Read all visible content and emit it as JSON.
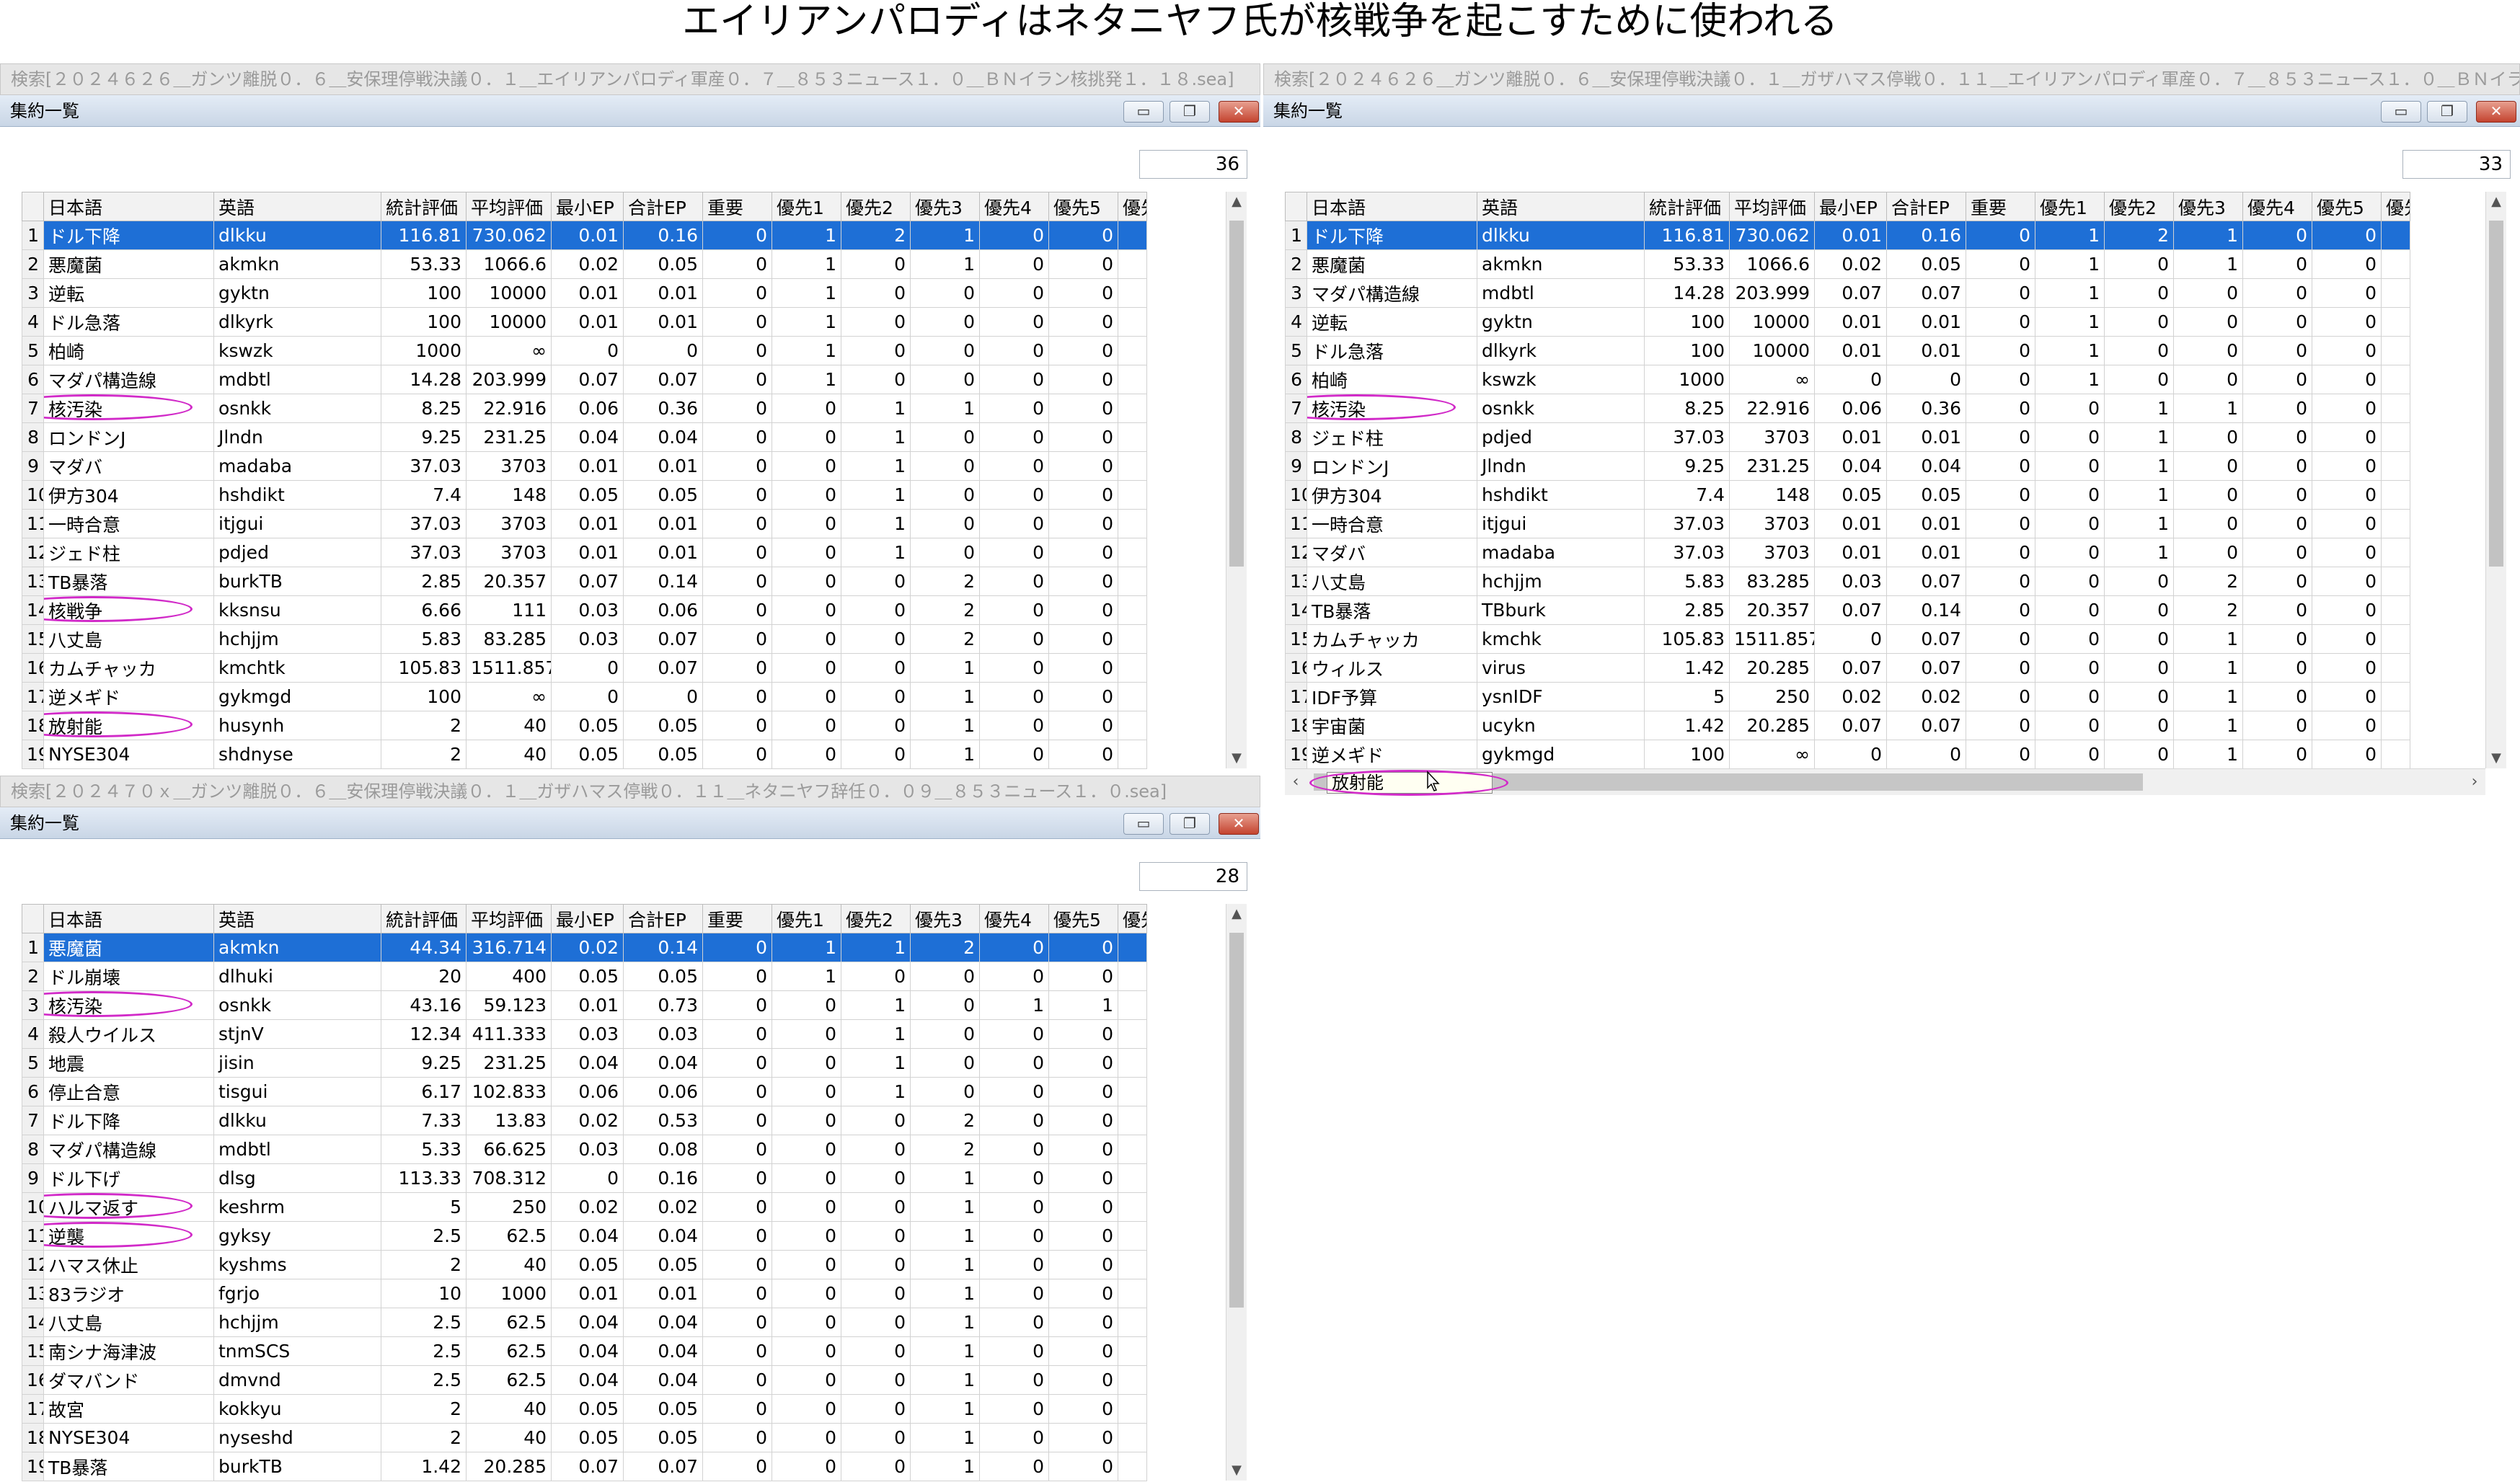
{
  "page_title": "エイリアンパロディはネタニヤフ氏が核戦争を起こすために使われる",
  "columns": [
    "日本語",
    "英語",
    "統計評価",
    "平均評価",
    "最小EP",
    "合計EP",
    "重要",
    "優先1",
    "優先2",
    "優先3",
    "優先4",
    "優先5",
    "優先"
  ],
  "windows": {
    "a": {
      "search_label": "検索",
      "search_text": "[２０２４６２６＿ガンツ離脱０．６＿安保理停戦決議０．１＿エイリアンパロディ軍産０．７＿８５３ニュース１．０＿ＢＮイラン核挑発１．１８.sea]",
      "window_title": "集約一覧",
      "count": "36",
      "rows": [
        {
          "i": "1",
          "ja": "ドル下降",
          "en": "dlkku",
          "v": [
            "116.81",
            "730.062",
            "0.01",
            "0.16",
            "0",
            "1",
            "2",
            "1",
            "0",
            "0"
          ],
          "sel": true
        },
        {
          "i": "2",
          "ja": "悪魔菌",
          "en": "akmkn",
          "v": [
            "53.33",
            "1066.6",
            "0.02",
            "0.05",
            "0",
            "1",
            "0",
            "1",
            "0",
            "0"
          ]
        },
        {
          "i": "3",
          "ja": "逆転",
          "en": "gyktn",
          "v": [
            "100",
            "10000",
            "0.01",
            "0.01",
            "0",
            "1",
            "0",
            "0",
            "0",
            "0"
          ]
        },
        {
          "i": "4",
          "ja": "ドル急落",
          "en": "dlkyrk",
          "v": [
            "100",
            "10000",
            "0.01",
            "0.01",
            "0",
            "1",
            "0",
            "0",
            "0",
            "0"
          ]
        },
        {
          "i": "5",
          "ja": "柏崎",
          "en": "kswzk",
          "v": [
            "1000",
            "∞",
            "0",
            "0",
            "0",
            "1",
            "0",
            "0",
            "0",
            "0"
          ]
        },
        {
          "i": "6",
          "ja": "マダパ構造線",
          "en": "mdbtl",
          "v": [
            "14.28",
            "203.999",
            "0.07",
            "0.07",
            "0",
            "1",
            "0",
            "0",
            "0",
            "0"
          ]
        },
        {
          "i": "7",
          "ja": "核汚染",
          "en": "osnkk",
          "v": [
            "8.25",
            "22.916",
            "0.06",
            "0.36",
            "0",
            "0",
            "1",
            "1",
            "0",
            "0"
          ],
          "circled": true
        },
        {
          "i": "8",
          "ja": "ロンドンJ",
          "en": "Jlndn",
          "v": [
            "9.25",
            "231.25",
            "0.04",
            "0.04",
            "0",
            "0",
            "1",
            "0",
            "0",
            "0"
          ]
        },
        {
          "i": "9",
          "ja": "マダバ",
          "en": "madaba",
          "v": [
            "37.03",
            "3703",
            "0.01",
            "0.01",
            "0",
            "0",
            "1",
            "0",
            "0",
            "0"
          ]
        },
        {
          "i": "10",
          "ja": "伊方304",
          "en": "hshdikt",
          "v": [
            "7.4",
            "148",
            "0.05",
            "0.05",
            "0",
            "0",
            "1",
            "0",
            "0",
            "0"
          ]
        },
        {
          "i": "11",
          "ja": "一時合意",
          "en": "itjgui",
          "v": [
            "37.03",
            "3703",
            "0.01",
            "0.01",
            "0",
            "0",
            "1",
            "0",
            "0",
            "0"
          ]
        },
        {
          "i": "12",
          "ja": "ジェド柱",
          "en": "pdjed",
          "v": [
            "37.03",
            "3703",
            "0.01",
            "0.01",
            "0",
            "0",
            "1",
            "0",
            "0",
            "0"
          ]
        },
        {
          "i": "13",
          "ja": "TB暴落",
          "en": "burkTB",
          "v": [
            "2.85",
            "20.357",
            "0.07",
            "0.14",
            "0",
            "0",
            "0",
            "2",
            "0",
            "0"
          ]
        },
        {
          "i": "14",
          "ja": "核戦争",
          "en": "kksnsu",
          "v": [
            "6.66",
            "111",
            "0.03",
            "0.06",
            "0",
            "0",
            "0",
            "2",
            "0",
            "0"
          ],
          "circled": true
        },
        {
          "i": "15",
          "ja": "八丈島",
          "en": "hchjjm",
          "v": [
            "5.83",
            "83.285",
            "0.03",
            "0.07",
            "0",
            "0",
            "0",
            "2",
            "0",
            "0"
          ]
        },
        {
          "i": "16",
          "ja": "カムチャッカ",
          "en": "kmchtk",
          "v": [
            "105.83",
            "1511.857",
            "0",
            "0.07",
            "0",
            "0",
            "0",
            "1",
            "0",
            "0"
          ]
        },
        {
          "i": "17",
          "ja": "逆メギド",
          "en": "gykmgd",
          "v": [
            "100",
            "∞",
            "0",
            "0",
            "0",
            "0",
            "0",
            "1",
            "0",
            "0"
          ]
        },
        {
          "i": "18",
          "ja": "放射能",
          "en": "husynh",
          "v": [
            "2",
            "40",
            "0.05",
            "0.05",
            "0",
            "0",
            "0",
            "1",
            "0",
            "0"
          ],
          "circled": true
        },
        {
          "i": "19",
          "ja": "NYSE304",
          "en": "shdnyse",
          "v": [
            "2",
            "40",
            "0.05",
            "0.05",
            "0",
            "0",
            "0",
            "1",
            "0",
            "0"
          ]
        }
      ]
    },
    "b": {
      "search_label": "検索",
      "search_text": "[２０２４６２６＿ガンツ離脱０．６＿安保理停戦決議０．１＿ガザハマス停戦０．１１＿エイリアンパロディ軍産０．７＿８５３ニュース１．０＿ＢＮイラン核挑発１",
      "window_title": "集約一覧",
      "count": "33",
      "tooltip_text": "放射能",
      "rows": [
        {
          "i": "1",
          "ja": "ドル下降",
          "en": "dlkku",
          "v": [
            "116.81",
            "730.062",
            "0.01",
            "0.16",
            "0",
            "1",
            "2",
            "1",
            "0",
            "0"
          ],
          "sel": true
        },
        {
          "i": "2",
          "ja": "悪魔菌",
          "en": "akmkn",
          "v": [
            "53.33",
            "1066.6",
            "0.02",
            "0.05",
            "0",
            "1",
            "0",
            "1",
            "0",
            "0"
          ]
        },
        {
          "i": "3",
          "ja": "マダパ構造線",
          "en": "mdbtl",
          "v": [
            "14.28",
            "203.999",
            "0.07",
            "0.07",
            "0",
            "1",
            "0",
            "0",
            "0",
            "0"
          ]
        },
        {
          "i": "4",
          "ja": "逆転",
          "en": "gyktn",
          "v": [
            "100",
            "10000",
            "0.01",
            "0.01",
            "0",
            "1",
            "0",
            "0",
            "0",
            "0"
          ]
        },
        {
          "i": "5",
          "ja": "ドル急落",
          "en": "dlkyrk",
          "v": [
            "100",
            "10000",
            "0.01",
            "0.01",
            "0",
            "1",
            "0",
            "0",
            "0",
            "0"
          ]
        },
        {
          "i": "6",
          "ja": "柏崎",
          "en": "kswzk",
          "v": [
            "1000",
            "∞",
            "0",
            "0",
            "0",
            "1",
            "0",
            "0",
            "0",
            "0"
          ]
        },
        {
          "i": "7",
          "ja": "核汚染",
          "en": "osnkk",
          "v": [
            "8.25",
            "22.916",
            "0.06",
            "0.36",
            "0",
            "0",
            "1",
            "1",
            "0",
            "0"
          ],
          "circled": true
        },
        {
          "i": "8",
          "ja": "ジェド柱",
          "en": "pdjed",
          "v": [
            "37.03",
            "3703",
            "0.01",
            "0.01",
            "0",
            "0",
            "1",
            "0",
            "0",
            "0"
          ]
        },
        {
          "i": "9",
          "ja": "ロンドンJ",
          "en": "Jlndn",
          "v": [
            "9.25",
            "231.25",
            "0.04",
            "0.04",
            "0",
            "0",
            "1",
            "0",
            "0",
            "0"
          ]
        },
        {
          "i": "10",
          "ja": "伊方304",
          "en": "hshdikt",
          "v": [
            "7.4",
            "148",
            "0.05",
            "0.05",
            "0",
            "0",
            "1",
            "0",
            "0",
            "0"
          ]
        },
        {
          "i": "11",
          "ja": "一時合意",
          "en": "itjgui",
          "v": [
            "37.03",
            "3703",
            "0.01",
            "0.01",
            "0",
            "0",
            "1",
            "0",
            "0",
            "0"
          ]
        },
        {
          "i": "12",
          "ja": "マダバ",
          "en": "madaba",
          "v": [
            "37.03",
            "3703",
            "0.01",
            "0.01",
            "0",
            "0",
            "1",
            "0",
            "0",
            "0"
          ]
        },
        {
          "i": "13",
          "ja": "八丈島",
          "en": "hchjjm",
          "v": [
            "5.83",
            "83.285",
            "0.03",
            "0.07",
            "0",
            "0",
            "0",
            "2",
            "0",
            "0"
          ]
        },
        {
          "i": "14",
          "ja": "TB暴落",
          "en": "TBburk",
          "v": [
            "2.85",
            "20.357",
            "0.07",
            "0.14",
            "0",
            "0",
            "0",
            "2",
            "0",
            "0"
          ]
        },
        {
          "i": "15",
          "ja": "カムチャッカ",
          "en": "kmchk",
          "v": [
            "105.83",
            "1511.857",
            "0",
            "0.07",
            "0",
            "0",
            "0",
            "1",
            "0",
            "0"
          ]
        },
        {
          "i": "16",
          "ja": "ウィルス",
          "en": "virus",
          "v": [
            "1.42",
            "20.285",
            "0.07",
            "0.07",
            "0",
            "0",
            "0",
            "1",
            "0",
            "0"
          ]
        },
        {
          "i": "17",
          "ja": "IDF予算",
          "en": "ysnIDF",
          "v": [
            "5",
            "250",
            "0.02",
            "0.02",
            "0",
            "0",
            "0",
            "1",
            "0",
            "0"
          ]
        },
        {
          "i": "18",
          "ja": "宇宙菌",
          "en": "ucykn",
          "v": [
            "1.42",
            "20.285",
            "0.07",
            "0.07",
            "0",
            "0",
            "0",
            "1",
            "0",
            "0"
          ]
        },
        {
          "i": "19",
          "ja": "逆メギド",
          "en": "gykmgd",
          "v": [
            "100",
            "∞",
            "0",
            "0",
            "0",
            "0",
            "0",
            "1",
            "0",
            "0"
          ]
        }
      ]
    },
    "c": {
      "search_label": "検索",
      "search_text": "[２０２４７０ｘ＿ガンツ離脱０．６＿安保理停戦決議０．１＿ガザハマス停戦０．１１＿ネタニヤフ辞任０．０９＿８５３ニュース１．０.sea]",
      "window_title": "集約一覧",
      "count": "28",
      "rows": [
        {
          "i": "1",
          "ja": "悪魔菌",
          "en": "akmkn",
          "v": [
            "44.34",
            "316.714",
            "0.02",
            "0.14",
            "0",
            "1",
            "1",
            "2",
            "0",
            "0"
          ],
          "sel": true
        },
        {
          "i": "2",
          "ja": "ドル崩壊",
          "en": "dlhuki",
          "v": [
            "20",
            "400",
            "0.05",
            "0.05",
            "0",
            "1",
            "0",
            "0",
            "0",
            "0"
          ]
        },
        {
          "i": "3",
          "ja": "核汚染",
          "en": "osnkk",
          "v": [
            "43.16",
            "59.123",
            "0.01",
            "0.73",
            "0",
            "0",
            "1",
            "0",
            "1",
            "1"
          ],
          "circled": true
        },
        {
          "i": "4",
          "ja": "殺人ウイルス",
          "en": "stjnV",
          "v": [
            "12.34",
            "411.333",
            "0.03",
            "0.03",
            "0",
            "0",
            "1",
            "0",
            "0",
            "0"
          ]
        },
        {
          "i": "5",
          "ja": "地震",
          "en": "jisin",
          "v": [
            "9.25",
            "231.25",
            "0.04",
            "0.04",
            "0",
            "0",
            "1",
            "0",
            "0",
            "0"
          ]
        },
        {
          "i": "6",
          "ja": "停止合意",
          "en": "tisgui",
          "v": [
            "6.17",
            "102.833",
            "0.06",
            "0.06",
            "0",
            "0",
            "1",
            "0",
            "0",
            "0"
          ]
        },
        {
          "i": "7",
          "ja": "ドル下降",
          "en": "dlkku",
          "v": [
            "7.33",
            "13.83",
            "0.02",
            "0.53",
            "0",
            "0",
            "0",
            "2",
            "0",
            "0"
          ]
        },
        {
          "i": "8",
          "ja": "マダパ構造線",
          "en": "mdbtl",
          "v": [
            "5.33",
            "66.625",
            "0.03",
            "0.08",
            "0",
            "0",
            "0",
            "2",
            "0",
            "0"
          ]
        },
        {
          "i": "9",
          "ja": "ドル下げ",
          "en": "dlsg",
          "v": [
            "113.33",
            "708.312",
            "0",
            "0.16",
            "0",
            "0",
            "0",
            "1",
            "0",
            "0"
          ]
        },
        {
          "i": "10",
          "ja": "ハルマ返す",
          "en": "keshrm",
          "v": [
            "5",
            "250",
            "0.02",
            "0.02",
            "0",
            "0",
            "0",
            "1",
            "0",
            "0"
          ],
          "circled": true
        },
        {
          "i": "11",
          "ja": "逆襲",
          "en": "gyksy",
          "v": [
            "2.5",
            "62.5",
            "0.04",
            "0.04",
            "0",
            "0",
            "0",
            "1",
            "0",
            "0"
          ],
          "circled": true
        },
        {
          "i": "12",
          "ja": "ハマス休止",
          "en": "kyshms",
          "v": [
            "2",
            "40",
            "0.05",
            "0.05",
            "0",
            "0",
            "0",
            "1",
            "0",
            "0"
          ]
        },
        {
          "i": "13",
          "ja": "83ラジオ",
          "en": "fgrjo",
          "v": [
            "10",
            "1000",
            "0.01",
            "0.01",
            "0",
            "0",
            "0",
            "1",
            "0",
            "0"
          ]
        },
        {
          "i": "14",
          "ja": "八丈島",
          "en": "hchjjm",
          "v": [
            "2.5",
            "62.5",
            "0.04",
            "0.04",
            "0",
            "0",
            "0",
            "1",
            "0",
            "0"
          ]
        },
        {
          "i": "15",
          "ja": "南シナ海津波",
          "en": "tnmSCS",
          "v": [
            "2.5",
            "62.5",
            "0.04",
            "0.04",
            "0",
            "0",
            "0",
            "1",
            "0",
            "0"
          ]
        },
        {
          "i": "16",
          "ja": "ダマバンド",
          "en": "dmvnd",
          "v": [
            "2.5",
            "62.5",
            "0.04",
            "0.04",
            "0",
            "0",
            "0",
            "1",
            "0",
            "0"
          ]
        },
        {
          "i": "17",
          "ja": "故宮",
          "en": "kokkyu",
          "v": [
            "2",
            "40",
            "0.05",
            "0.05",
            "0",
            "0",
            "0",
            "1",
            "0",
            "0"
          ]
        },
        {
          "i": "18",
          "ja": "NYSE304",
          "en": "nyseshd",
          "v": [
            "2",
            "40",
            "0.05",
            "0.05",
            "0",
            "0",
            "0",
            "1",
            "0",
            "0"
          ]
        },
        {
          "i": "19",
          "ja": "TB暴落",
          "en": "burkTB",
          "v": [
            "1.42",
            "20.285",
            "0.07",
            "0.07",
            "0",
            "0",
            "0",
            "1",
            "0",
            "0"
          ]
        }
      ]
    }
  },
  "icons": {
    "minimize": "minimize-icon",
    "restore": "restore-icon",
    "close": "close-icon",
    "scroll_up": "chevron-up-icon",
    "scroll_down": "chevron-down-icon",
    "scroll_left": "chevron-left-icon",
    "scroll_right": "chevron-right-icon"
  },
  "colors": {
    "selection": "#1e6fd6",
    "annotation_ring": "#d12ac8",
    "close_button": "#c4432f"
  }
}
